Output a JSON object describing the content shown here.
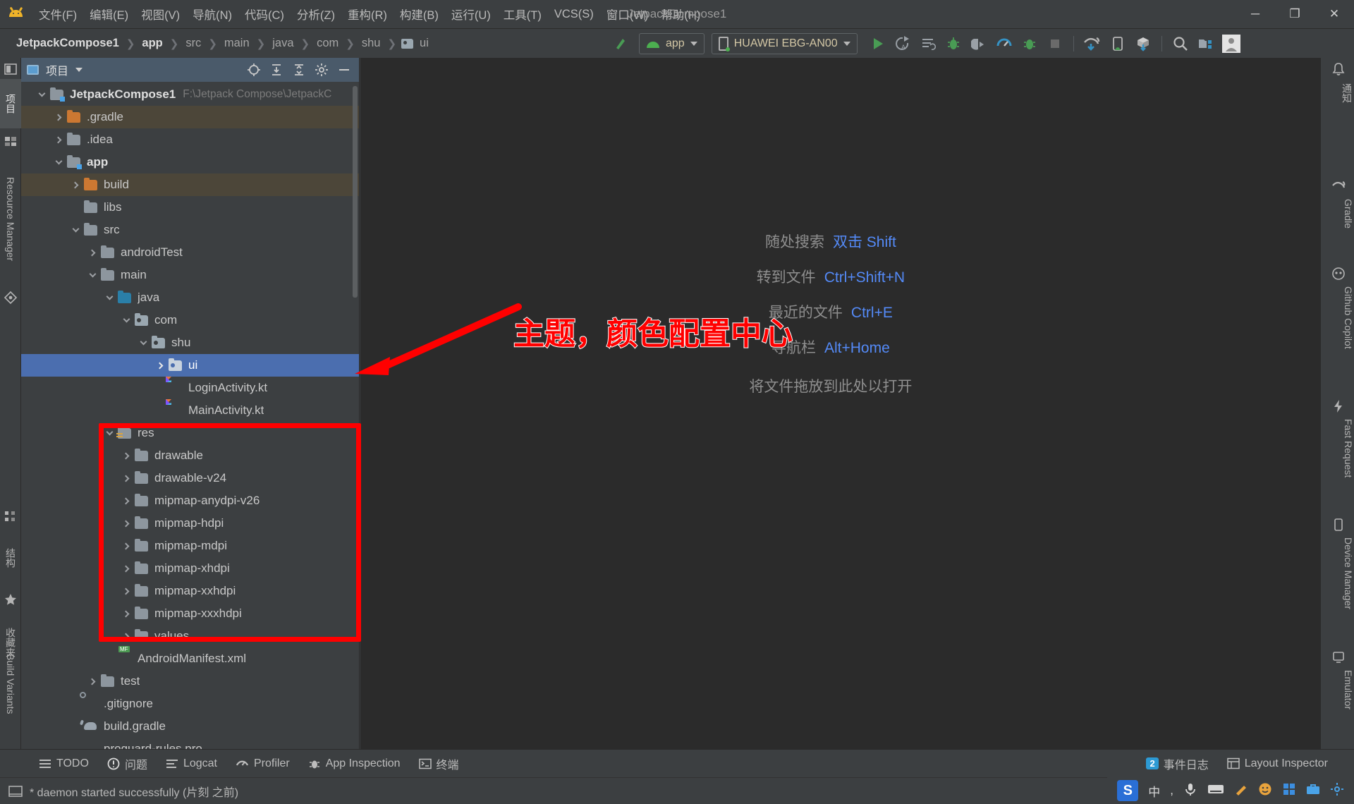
{
  "window": {
    "title": "JetpackCompose1",
    "minimize": "─",
    "maximize": "❐",
    "close": "✕"
  },
  "menu": {
    "items": [
      "文件(F)",
      "编辑(E)",
      "视图(V)",
      "导航(N)",
      "代码(C)",
      "分析(Z)",
      "重构(R)",
      "构建(B)",
      "运行(U)",
      "工具(T)",
      "VCS(S)",
      "窗口(W)",
      "帮助(H)"
    ]
  },
  "breadcrumb": {
    "items": [
      "JetpackCompose1",
      "app",
      "src",
      "main",
      "java",
      "com",
      "shu",
      "ui"
    ]
  },
  "toolbar": {
    "module_selector": "app",
    "device_selector": "HUAWEI EBG-AN00",
    "icons": [
      "make-project-icon",
      "run-icon",
      "apply-changes-icon",
      "apply-code-changes-icon",
      "debug-icon",
      "attach-debugger-icon",
      "profiler-icon",
      "run-with-coverage-icon",
      "stop-icon",
      "gradle-sync-icon",
      "avd-manager-icon",
      "sdk-manager-icon",
      "search-everywhere-icon",
      "project-structure-icon",
      "account-icon"
    ]
  },
  "left_strip": {
    "tabs": [
      "项目",
      "收藏夹",
      "结构"
    ],
    "bottom_tab": "Build Variants",
    "resource_manager": "Resource Manager"
  },
  "right_strip": {
    "tabs": [
      "通知",
      "Gradle",
      "Github Copilot",
      "Fast Request",
      "Device Manager",
      "Emulator"
    ]
  },
  "project_panel": {
    "header_title": "项目",
    "header_icons": [
      "locate-icon",
      "expand-all-icon",
      "collapse-all-icon",
      "settings-icon",
      "hide-icon"
    ],
    "root_path": "F:\\Jetpack Compose\\JetpackC",
    "tree": [
      {
        "label": "JetpackCompose1",
        "depth": 0,
        "twisty": "open",
        "icon": "module",
        "bold": true,
        "path": "F:\\Jetpack Compose\\JetpackC"
      },
      {
        "label": ".gradle",
        "depth": 1,
        "twisty": "closed",
        "icon": "orange",
        "excluded": true
      },
      {
        "label": ".idea",
        "depth": 1,
        "twisty": "closed",
        "icon": "gray"
      },
      {
        "label": "app",
        "depth": 1,
        "twisty": "open",
        "icon": "module",
        "bold": true
      },
      {
        "label": "build",
        "depth": 2,
        "twisty": "closed",
        "icon": "orange",
        "excluded": true
      },
      {
        "label": "libs",
        "depth": 2,
        "twisty": "none",
        "icon": "gray"
      },
      {
        "label": "src",
        "depth": 2,
        "twisty": "open",
        "icon": "gray"
      },
      {
        "label": "androidTest",
        "depth": 3,
        "twisty": "closed",
        "icon": "gray"
      },
      {
        "label": "main",
        "depth": 3,
        "twisty": "open",
        "icon": "gray"
      },
      {
        "label": "java",
        "depth": 4,
        "twisty": "open",
        "icon": "blue"
      },
      {
        "label": "com",
        "depth": 5,
        "twisty": "open",
        "icon": "pkg"
      },
      {
        "label": "shu",
        "depth": 6,
        "twisty": "open",
        "icon": "pkg"
      },
      {
        "label": "ui",
        "depth": 7,
        "twisty": "closed",
        "icon": "pkg",
        "selected": true
      },
      {
        "label": "LoginActivity.kt",
        "depth": 7,
        "twisty": "none",
        "icon": "kotlin"
      },
      {
        "label": "MainActivity.kt",
        "depth": 7,
        "twisty": "none",
        "icon": "kotlin"
      },
      {
        "label": "res",
        "depth": 4,
        "twisty": "open",
        "icon": "res"
      },
      {
        "label": "drawable",
        "depth": 5,
        "twisty": "closed",
        "icon": "gray"
      },
      {
        "label": "drawable-v24",
        "depth": 5,
        "twisty": "closed",
        "icon": "gray"
      },
      {
        "label": "mipmap-anydpi-v26",
        "depth": 5,
        "twisty": "closed",
        "icon": "gray"
      },
      {
        "label": "mipmap-hdpi",
        "depth": 5,
        "twisty": "closed",
        "icon": "gray"
      },
      {
        "label": "mipmap-mdpi",
        "depth": 5,
        "twisty": "closed",
        "icon": "gray"
      },
      {
        "label": "mipmap-xhdpi",
        "depth": 5,
        "twisty": "closed",
        "icon": "gray"
      },
      {
        "label": "mipmap-xxhdpi",
        "depth": 5,
        "twisty": "closed",
        "icon": "gray"
      },
      {
        "label": "mipmap-xxxhdpi",
        "depth": 5,
        "twisty": "closed",
        "icon": "gray"
      },
      {
        "label": "values",
        "depth": 5,
        "twisty": "closed",
        "icon": "gray"
      },
      {
        "label": "AndroidManifest.xml",
        "depth": 4,
        "twisty": "none",
        "icon": "xml"
      },
      {
        "label": "test",
        "depth": 3,
        "twisty": "closed",
        "icon": "gray"
      },
      {
        "label": ".gitignore",
        "depth": 2,
        "twisty": "none",
        "icon": "ignore"
      },
      {
        "label": "build.gradle",
        "depth": 2,
        "twisty": "none",
        "icon": "gradle"
      },
      {
        "label": "proguard-rules.pro",
        "depth": 2,
        "twisty": "none",
        "icon": "file"
      }
    ]
  },
  "editor": {
    "hints": [
      {
        "text": "随处搜索",
        "key": "双击 Shift"
      },
      {
        "text": "转到文件",
        "key": "Ctrl+Shift+N"
      },
      {
        "text": "最近的文件",
        "key": "Ctrl+E"
      },
      {
        "text": "导航栏",
        "key": "Alt+Home"
      },
      {
        "text": "将文件拖放到此处以打开",
        "key": ""
      }
    ]
  },
  "annotations": {
    "overlay_text": "主题，颜色配置中心",
    "color": "#ff0000"
  },
  "status_bar": {
    "items": [
      {
        "label": "TODO",
        "icon": "todo-icon"
      },
      {
        "label": "问题",
        "icon": "problems-icon"
      },
      {
        "label": "Logcat",
        "icon": "logcat-icon"
      },
      {
        "label": "Profiler",
        "icon": "profiler-icon"
      },
      {
        "label": "App Inspection",
        "icon": "app-inspection-icon"
      },
      {
        "label": "终端",
        "icon": "terminal-icon"
      }
    ],
    "right_items": [
      {
        "label": "事件日志",
        "icon": "event-log-icon",
        "count": "2"
      },
      {
        "label": "Layout Inspector",
        "icon": "layout-inspector-icon"
      }
    ]
  },
  "info_bar": {
    "message": "* daemon started successfully (片刻 之前)"
  },
  "ime": {
    "app": "sogou-pinyin",
    "mode": "中",
    "icons": [
      "comma-icon",
      "mic-icon",
      "keyboard-icon",
      "pencil-icon",
      "smiley-icon",
      "grid-icon",
      "toolbox-icon",
      "settings-icon"
    ]
  }
}
